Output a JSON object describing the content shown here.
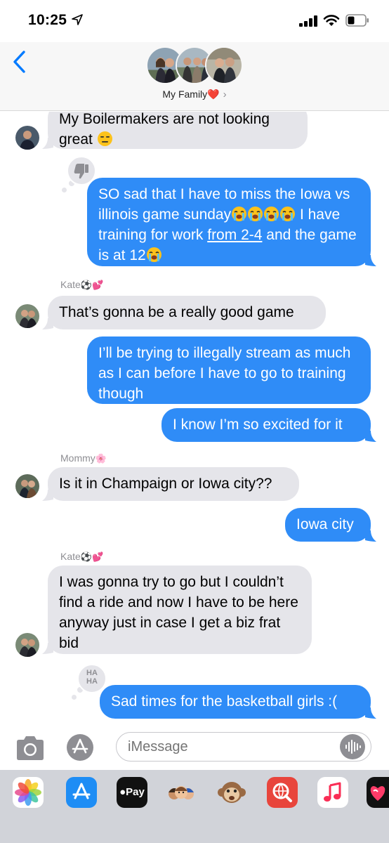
{
  "status_bar": {
    "time": "10:25",
    "icons": [
      "location-arrow-icon",
      "cellular-signal-icon",
      "wifi-icon",
      "battery-icon"
    ]
  },
  "header": {
    "back_icon": "chevron-left-icon",
    "group_name": "My Family",
    "group_emoji": "❤️",
    "chevron": "›",
    "member_avatars": 3
  },
  "messages": [
    {
      "id": "m1",
      "direction": "incoming",
      "sender": "",
      "text": "My Boilermakers are not looking great",
      "emoji": "😑"
    },
    {
      "id": "m2",
      "direction": "outgoing",
      "tapback": "thumbs-down",
      "text_1": "SO sad that I have to miss the Iowa vs illinois game sunday",
      "emoji_run": "😭😭😭😭",
      "text_2": "I have training for work",
      "link": "from 2-4",
      "text_3": "and the game is at 12",
      "end_emoji": "😭"
    },
    {
      "id": "m3",
      "direction": "incoming",
      "sender": "Kate⚽️💕",
      "text": "That’s gonna be a really good game"
    },
    {
      "id": "m4",
      "direction": "outgoing",
      "text": "I’ll be trying to illegally stream as much as I can before I have to go to training though"
    },
    {
      "id": "m5",
      "direction": "outgoing",
      "text": "I know I’m so excited for it"
    },
    {
      "id": "m6",
      "direction": "incoming",
      "sender": "Mommy🌸",
      "text": "Is it in Champaign or Iowa city??"
    },
    {
      "id": "m7",
      "direction": "outgoing",
      "text": "Iowa city"
    },
    {
      "id": "m8",
      "direction": "incoming",
      "sender": "Kate⚽️💕",
      "text": "I was gonna try to go but I couldn’t find a ride and now I have to be here anyway just in case I get a biz frat bid"
    },
    {
      "id": "m9",
      "direction": "outgoing",
      "tapback": "haha",
      "tapback_text": "HA HA",
      "text": "Sad times for the basketball girls :("
    }
  ],
  "senders": {
    "kate": "Kate",
    "kate_emoji": "⚽️💕",
    "mommy": "Mommy",
    "mommy_emoji": "🌸"
  },
  "input_bar": {
    "placeholder": "iMessage",
    "icons": [
      "camera-icon",
      "app-store-icon",
      "audio-waveform-icon"
    ]
  },
  "app_drawer": {
    "apps": [
      "photos-app-icon",
      "app-store-app-icon",
      "apple-pay-app-icon",
      "memoji-app-icon",
      "animoji-app-icon",
      "web-search-app-icon",
      "music-app-icon",
      "digital-touch-app-icon"
    ],
    "apple_pay_label": "Pay"
  },
  "colors": {
    "outgoing_bubble": "#2f8cf7",
    "incoming_bubble": "#e5e5ea",
    "accent": "#007aff",
    "timestamp_gray": "#8e8e93"
  }
}
